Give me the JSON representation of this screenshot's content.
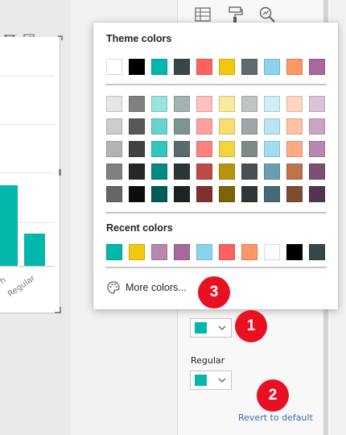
{
  "visual": {
    "axis_labels": [
      "h",
      "Regular"
    ],
    "bar_color": "#01b8aa"
  },
  "pane": {
    "regular_label": "Regular",
    "revert_label": "Revert to default",
    "selected_color_1": "#01b8aa",
    "selected_color_2": "#01b8aa"
  },
  "picker": {
    "theme_title": "Theme colors",
    "recent_title": "Recent colors",
    "more_colors_label": "More colors...",
    "theme_row": [
      "#ffffff",
      "#000000",
      "#01b8aa",
      "#374649",
      "#fd625e",
      "#f2c80f",
      "#5f6b6d",
      "#8ad4eb",
      "#fe9666",
      "#a66999"
    ],
    "shade_rows": [
      [
        "#e6e6e6",
        "#808080",
        "#99e3dd",
        "#a5b1b3",
        "#fec0bf",
        "#faea9f",
        "#bfc4c5",
        "#d0eef7",
        "#ffd5c2",
        "#dbc3d6"
      ],
      [
        "#cccccc",
        "#595959",
        "#67d4cc",
        "#7f9295",
        "#fea19e",
        "#f7de6f",
        "#9fa6a7",
        "#b9e5f3",
        "#ffc0a3",
        "#c9a5c1"
      ],
      [
        "#b3b3b3",
        "#404040",
        "#34c6bb",
        "#596b6e",
        "#fe817e",
        "#f5d33f",
        "#7f898a",
        "#a1ddef",
        "#feab85",
        "#b887ad"
      ],
      [
        "#808080",
        "#262626",
        "#018a80",
        "#293537",
        "#be4a47",
        "#b5960b",
        "#475052",
        "#689fb0",
        "#be714d",
        "#7c4f73"
      ],
      [
        "#666666",
        "#0d0d0d",
        "#005c55",
        "#1c2325",
        "#7f312f",
        "#796408",
        "#303637",
        "#456a76",
        "#7f4b33",
        "#53354d"
      ]
    ],
    "recent_row": [
      "#01b8aa",
      "#f2c80f",
      "#b887ad",
      "#a66999",
      "#8ad4eb",
      "#fd625e",
      "#fe9666",
      "#ffffff",
      "#000000",
      "#374649"
    ]
  },
  "callouts": {
    "one": "1",
    "two": "2",
    "three": "3",
    "color": "#e81123"
  }
}
